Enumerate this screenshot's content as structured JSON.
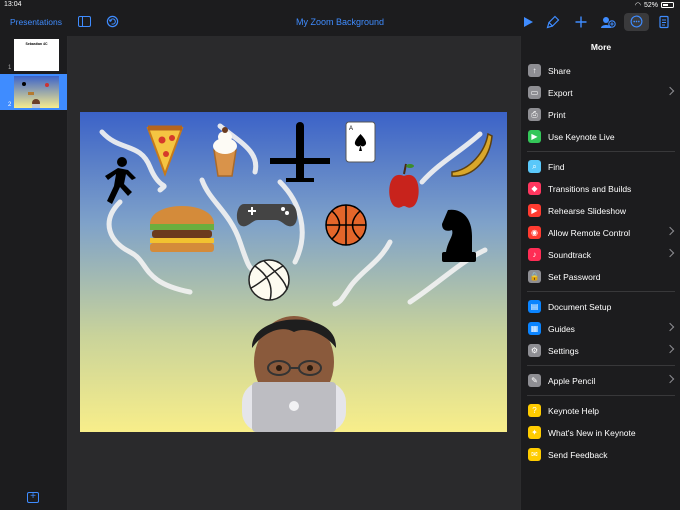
{
  "status": {
    "time": "13:04",
    "battery": "52%"
  },
  "toolbar": {
    "back_label": "Presentations",
    "title": "My Zoom Background"
  },
  "navigator": {
    "slides": [
      {
        "number": "1",
        "title": "Sebastian 4C"
      },
      {
        "number": "2"
      }
    ]
  },
  "panel": {
    "title": "More",
    "groups": [
      [
        {
          "label": "Share",
          "icon": "share-icon",
          "color": "#8e8e93",
          "chevron": false
        },
        {
          "label": "Export",
          "icon": "export-icon",
          "color": "#8e8e93",
          "chevron": true
        },
        {
          "label": "Print",
          "icon": "print-icon",
          "color": "#8e8e93",
          "chevron": false
        },
        {
          "label": "Use Keynote Live",
          "icon": "keynote-live-icon",
          "color": "#34c759",
          "chevron": false
        }
      ],
      [
        {
          "label": "Find",
          "icon": "find-icon",
          "color": "#5ac8fa",
          "chevron": false
        },
        {
          "label": "Transitions and Builds",
          "icon": "transitions-icon",
          "color": "#ff375f",
          "chevron": false
        },
        {
          "label": "Rehearse Slideshow",
          "icon": "rehearse-icon",
          "color": "#ff3b30",
          "chevron": false
        },
        {
          "label": "Allow Remote Control",
          "icon": "remote-icon",
          "color": "#ff3b30",
          "chevron": true
        },
        {
          "label": "Soundtrack",
          "icon": "soundtrack-icon",
          "color": "#ff2d55",
          "chevron": true
        },
        {
          "label": "Set Password",
          "icon": "lock-icon",
          "color": "#8e8e93",
          "chevron": false
        }
      ],
      [
        {
          "label": "Document Setup",
          "icon": "document-setup-icon",
          "color": "#0a84ff",
          "chevron": false
        },
        {
          "label": "Guides",
          "icon": "guides-icon",
          "color": "#0a84ff",
          "chevron": true
        },
        {
          "label": "Settings",
          "icon": "wrench-icon",
          "color": "#8e8e93",
          "chevron": true
        }
      ],
      [
        {
          "label": "Apple Pencil",
          "icon": "pencil-icon",
          "color": "#8e8e93",
          "chevron": true
        }
      ],
      [
        {
          "label": "Keynote Help",
          "icon": "help-icon",
          "color": "#ffcc00",
          "chevron": false
        },
        {
          "label": "What's New in Keynote",
          "icon": "whats-new-icon",
          "color": "#ffcc00",
          "chevron": false
        },
        {
          "label": "Send Feedback",
          "icon": "feedback-icon",
          "color": "#ffcc00",
          "chevron": false
        }
      ]
    ]
  },
  "accent": "#3f8cff"
}
